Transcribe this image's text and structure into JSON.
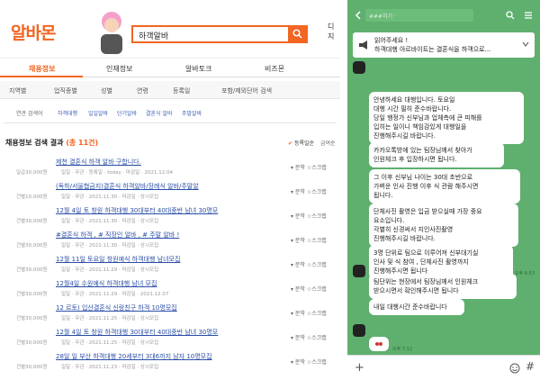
{
  "left": {
    "logo": "알바몬",
    "search_value": "하객알바",
    "top_link": "디지",
    "tabs": [
      "채용정보",
      "인재정보",
      "알바토크",
      "비즈몬"
    ],
    "filters": [
      "지역별",
      "업직종별",
      "성별",
      "연령",
      "등록일",
      "포함/제외단어 검색"
    ],
    "related_label": "연관 검색어",
    "related": [
      "하객대행",
      "일일알바",
      "단기알바",
      "결혼식 알바",
      "주말알바"
    ],
    "results_title": "채용정보 검색 결과",
    "results_count": "(총 11건)",
    "sort_primary": "등록일순",
    "sort_secondary": "금여순",
    "rows": [
      {
        "title": "제천 결혼식 하객 알바 구합니다.",
        "pay": "일급30,000원",
        "meta": "일일 · 무관 · 등록일 · today · 마감일 · 2021.12.04"
      },
      {
        "title": "(독하/서울협금지)결혼식 하객알바/장례식 알바/주말알",
        "pay": "건별10,000원",
        "meta": "일일 · 무관 · 2021.11.30 · 마감일 · 상시모집"
      },
      {
        "title": "12월 4일 토 창원 하객대행 30대부터 40대중반 남녀 30명모",
        "pay": "건별30,000원",
        "meta": "일일 · 무관 · 2021.11.30 · 마감일 · 상시모집"
      },
      {
        "title": "#결혼식 하객 , # 직장인 알바 , # 주말 알바 !",
        "pay": "건별30,000원",
        "meta": "일일 · 무관 · 2021.11.30 · 마감일 · 상시모집"
      },
      {
        "title": "12월 11일 토요일 창원예식 하객대행 남녀모집",
        "pay": "건별30,000원",
        "meta": "일일 · 무관 · 2021.11.29 · 마감일 · 상시모집"
      },
      {
        "title": "12월4일 수원예식 하객대행 남녀 모집",
        "pay": "건별30,000원",
        "meta": "일일 · 무관 · 2021.11.29 · 마감일 · 2021.12.07"
      },
      {
        "title": "12 르토) 입산결혼식 신랑친구 하객 10명모집",
        "pay": "건별30,000원",
        "meta": "일일 · 무관 · 2021.11.25 · 마감일 · 상시모집"
      },
      {
        "title": "12월 4일 토 창원 하객대행 30대부터 40대중반 남녀 30명모",
        "pay": "건별30,000원",
        "meta": "일일 · 무관 · 2021.11.25 · 마감일 · 상시모집"
      },
      {
        "title": "28일 일 부산 하객대행 20세부터 3대6까지 남자 10명모집",
        "pay": "건별30,000원",
        "meta": "일일 · 무관 · 2021.11.23 · 마감일 · 상시모집"
      }
    ],
    "row_actions": {
      "apply": "문학",
      "scrap": "스크랩"
    }
  },
  "right": {
    "chat_name": "###하기 ·",
    "notice": [
      "읽어주세요 !",
      "하객대행 아르바이트는 결혼식을 하객으로..."
    ],
    "messages": [
      {
        "lines": [
          "안녕하세요        대행입니다. 토요일",
          "대행 시간 필히 준수바랍니다.",
          "당일 행정가 신부님과 업체측에 큰 피해를",
          "입히는 일이니 책임감있게 대행일을",
          "진행해주시길 바랍니다."
        ]
      },
      {
        "lines": [
          "카카오톡방에 있는 팀장님께서 찾아가",
          "인원체크 후 입장하시면 됩니다."
        ]
      },
      {
        "lines": [
          "그 이후 신부님 나이는 30대 초반으로",
          "가벼운 인사 진행 이후 식 관람 해주시면",
          "됩니다."
        ]
      },
      {
        "lines": [
          "단체사진 촬영은 입금 받으실때 가장 중요",
          "요소입니다.",
          "각별히 신경써서 지인사진촬영",
          "진행해주시길 바랍니다."
        ]
      },
      {
        "lines": [
          "3명 단위로 팀으로 이루어져 신부대기실",
          "인사 및 식 참여 , 단체사진 촬영까지",
          "진행해주시면 됩니다"
        ]
      },
      {
        "lines": [
          "팀단위는 현장에서 팀장님께서 인원체크",
          "받으시면서 확인해주시면 됩니다"
        ]
      },
      {
        "lines": [
          "내일 대행시간 준수바랍니다"
        ]
      }
    ],
    "stamp1": "오후 6:53",
    "stamp2": "오후 7:12"
  }
}
